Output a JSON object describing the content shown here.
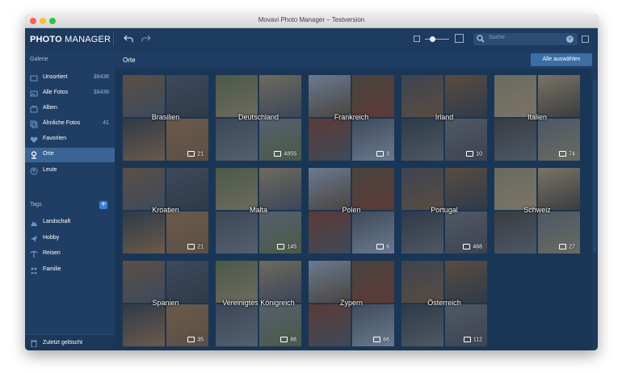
{
  "window": {
    "title": "Movavi Photo Manager – Testversion"
  },
  "toolbar": {
    "logo_bold": "PHOTO",
    "logo_rest": " MANAGER",
    "undo_icon": "undo-icon",
    "redo_icon": "redo-icon",
    "search_placeholder": "Suche"
  },
  "sidebar": {
    "gallery_header": "Galerie",
    "items": [
      {
        "label": "Unsortiert",
        "count": "38436",
        "icon": "unsorted-icon"
      },
      {
        "label": "Alle Fotos",
        "count": "38436",
        "icon": "all-photos-icon"
      },
      {
        "label": "Alben",
        "count": "",
        "icon": "albums-icon"
      },
      {
        "label": "Ähnliche Fotos",
        "count": "41",
        "icon": "similar-photos-icon"
      },
      {
        "label": "Favoriten",
        "count": "",
        "icon": "heart-icon"
      },
      {
        "label": "Orte",
        "count": "",
        "icon": "location-pin-icon"
      },
      {
        "label": "Leute",
        "count": "",
        "icon": "people-icon"
      }
    ],
    "tags_header": "Tags",
    "tags": [
      {
        "label": "Landschaft",
        "icon": "landscape-tag-icon"
      },
      {
        "label": "Hobby",
        "icon": "hobby-tag-icon"
      },
      {
        "label": "Reisen",
        "icon": "travel-tag-icon"
      },
      {
        "label": "Familie",
        "icon": "family-tag-icon"
      }
    ],
    "bottom": {
      "label": "Zuletzt gelöscht",
      "icon": "trash-icon"
    }
  },
  "main": {
    "title": "Orte",
    "select_all": "Alle auswählen",
    "places": [
      {
        "name": "Brasilien",
        "count": "21"
      },
      {
        "name": "Deutschland",
        "count": "4855"
      },
      {
        "name": "Frankreich",
        "count": "3"
      },
      {
        "name": "Irland",
        "count": "10"
      },
      {
        "name": "Italien",
        "count": "74"
      },
      {
        "name": "Kroatien",
        "count": "21"
      },
      {
        "name": "Malta",
        "count": "145"
      },
      {
        "name": "Polen",
        "count": "6"
      },
      {
        "name": "Portugal",
        "count": "468"
      },
      {
        "name": "Schweiz",
        "count": "27"
      },
      {
        "name": "Spanien",
        "count": "35"
      },
      {
        "name": "Vereinigtes Königreich",
        "count": "88"
      },
      {
        "name": "Zypern",
        "count": "66"
      },
      {
        "name": "Österreich",
        "count": "112"
      }
    ]
  },
  "colors": {
    "window_bg": "#1e3a5f",
    "sidebar_active": "#3b6494",
    "accent_button": "#3a6ea5"
  }
}
